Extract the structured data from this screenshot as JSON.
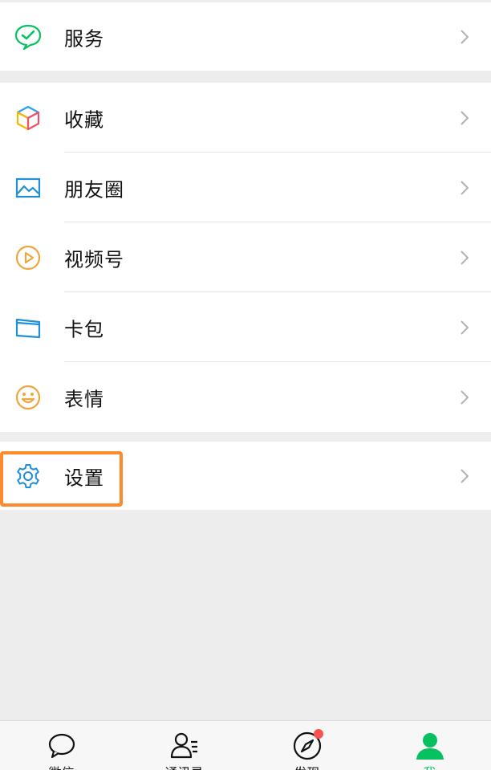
{
  "menu": {
    "services": {
      "label": "服务",
      "icon": "services-icon"
    },
    "favorites": {
      "label": "收藏",
      "icon": "cube-icon"
    },
    "moments": {
      "label": "朋友圈",
      "icon": "image-icon"
    },
    "channels": {
      "label": "视频号",
      "icon": "play-circle-icon"
    },
    "cards": {
      "label": "卡包",
      "icon": "wallet-icon"
    },
    "stickers": {
      "label": "表情",
      "icon": "smiley-icon"
    },
    "settings": {
      "label": "设置",
      "icon": "gear-icon"
    }
  },
  "tabbar": {
    "tabs": [
      {
        "label": "微信",
        "icon": "chat-bubble-icon",
        "active": false
      },
      {
        "label": "通讯录",
        "icon": "contacts-icon",
        "active": false
      },
      {
        "label": "发现",
        "icon": "compass-icon",
        "active": false,
        "badge": true
      },
      {
        "label": "我",
        "icon": "person-icon",
        "active": true
      }
    ]
  },
  "colors": {
    "accent": "#07c160",
    "highlight": "#ff8a2a",
    "badge": "#fa5151",
    "background": "#ededed"
  }
}
